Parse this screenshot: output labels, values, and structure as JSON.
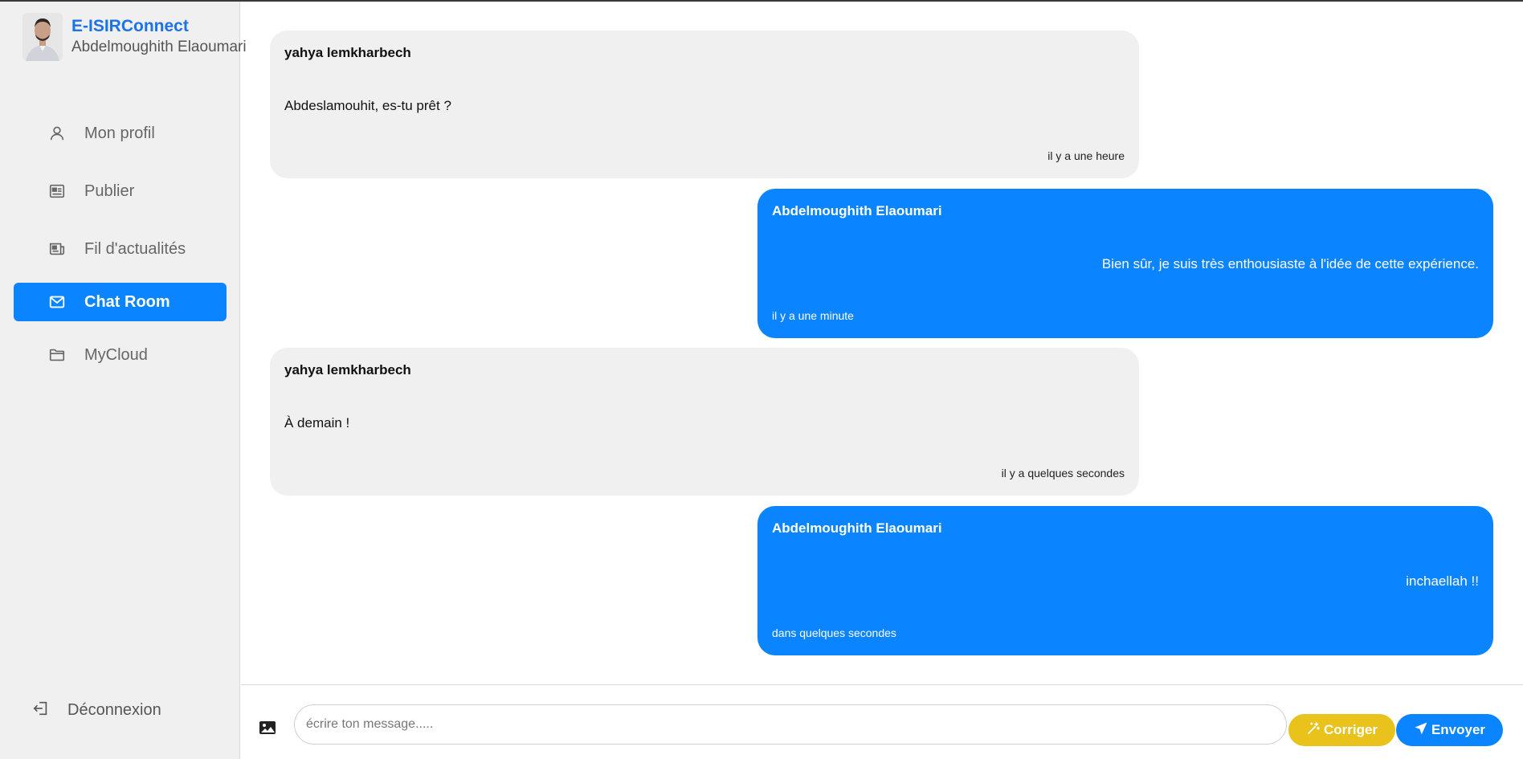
{
  "app": {
    "title": "E-ISIRConnect",
    "user_name": "Abdelmoughith Elaoumari",
    "colors": {
      "accent": "#0a84ff",
      "brand_text": "#1a73e8",
      "fix_button": "#e9c21c"
    }
  },
  "sidebar": {
    "items": [
      {
        "label": "Mon profil",
        "icon": "user-icon",
        "active": false
      },
      {
        "label": "Publier",
        "icon": "newspaper-icon",
        "active": false
      },
      {
        "label": "Fil d'actualités",
        "icon": "news-feed-icon",
        "active": false
      },
      {
        "label": "Chat Room",
        "icon": "mail-icon",
        "active": true
      },
      {
        "label": "MyCloud",
        "icon": "folder-icon",
        "active": false
      }
    ],
    "logout_label": "Déconnexion"
  },
  "messages": [
    {
      "sender": "yahya lemkharbech",
      "text": "Abdeslamouhit, es-tu prêt ?",
      "time": "il y a une heure",
      "direction": "incoming"
    },
    {
      "sender": "Abdelmoughith Elaoumari",
      "text": "Bien sûr, je suis très enthousiaste à l'idée de cette expérience.",
      "time": "il y a une minute",
      "direction": "outgoing"
    },
    {
      "sender": "yahya lemkharbech",
      "text": "À demain !",
      "time": "il y a quelques secondes",
      "direction": "incoming"
    },
    {
      "sender": "Abdelmoughith Elaoumari",
      "text": "inchaellah !!",
      "time": "dans quelques secondes",
      "direction": "outgoing"
    }
  ],
  "composer": {
    "placeholder": "écrire ton message.....",
    "value": "",
    "fix_label": "Corriger",
    "send_label": "Envoyer"
  }
}
